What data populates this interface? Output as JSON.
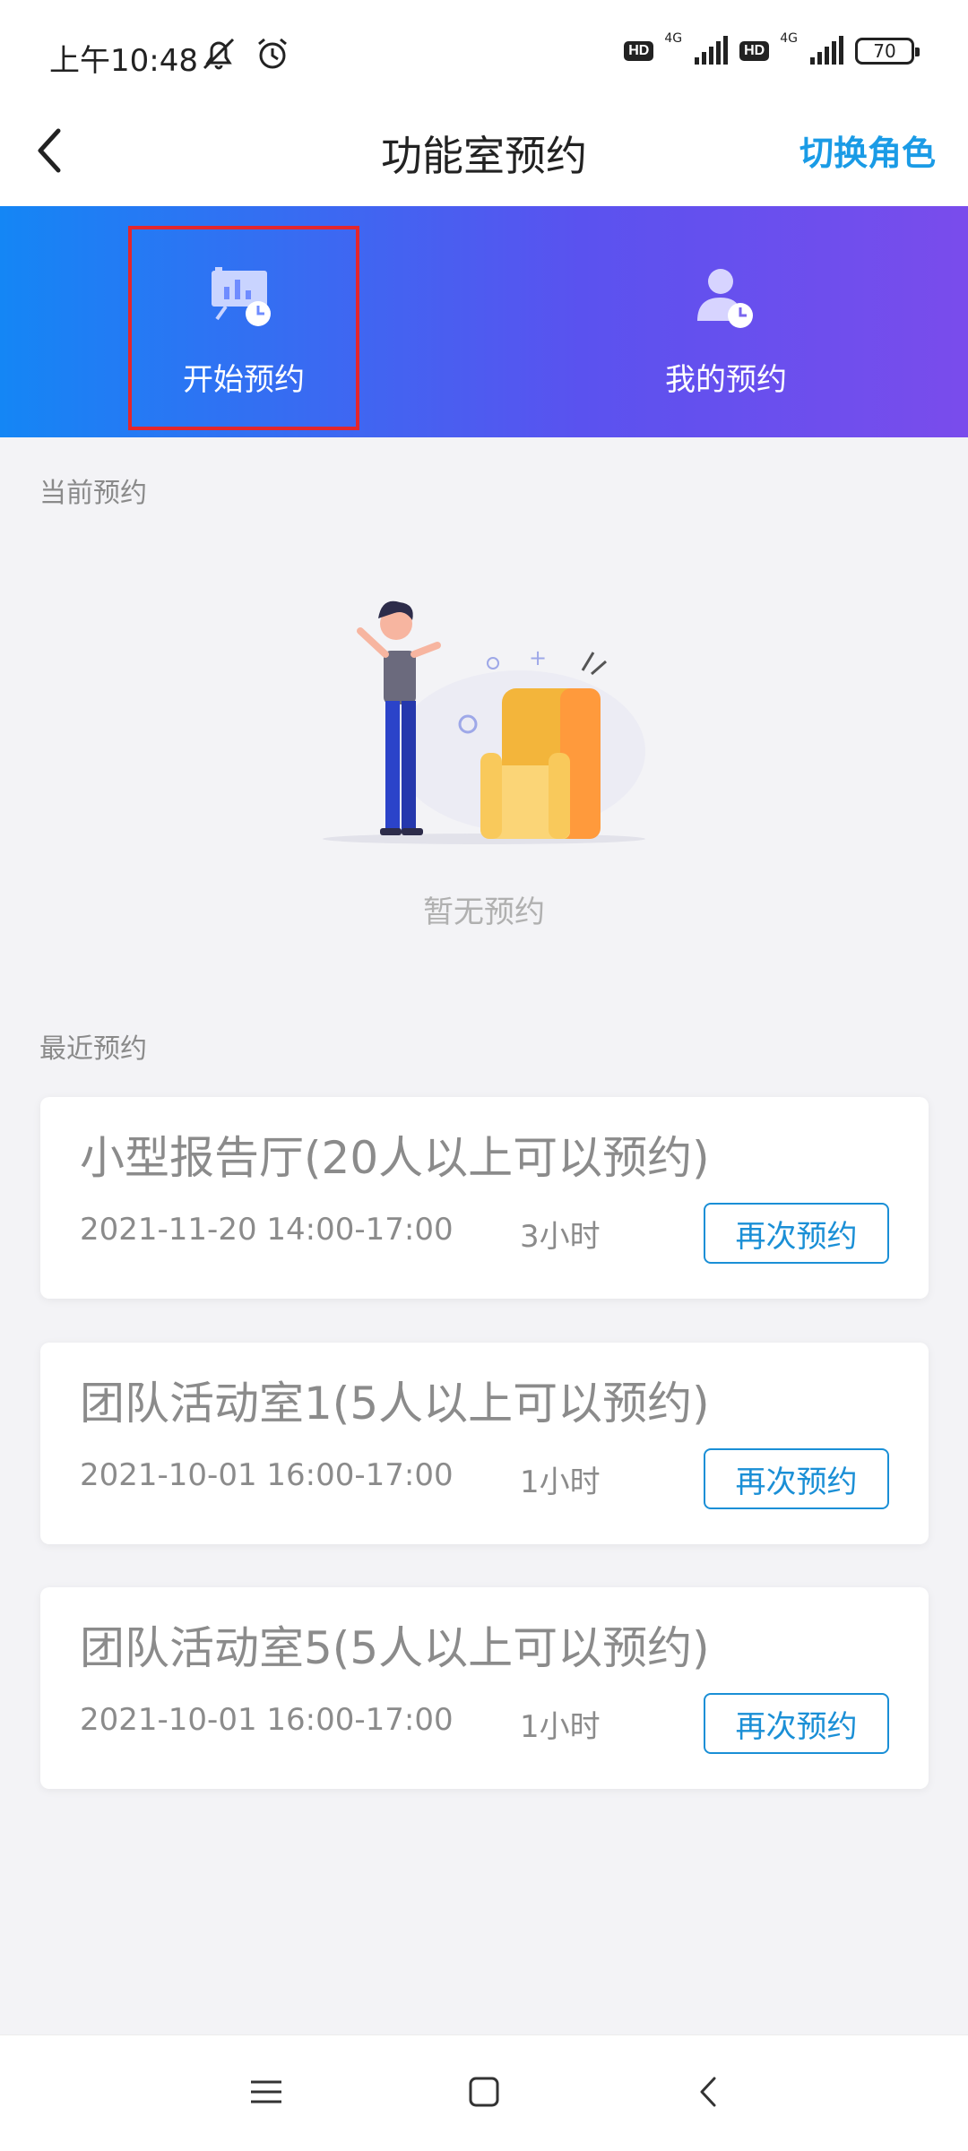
{
  "status_bar": {
    "time": "上午10:48",
    "net_type_1": "4G",
    "net_type_2": "4G",
    "hd_1": "HD",
    "hd_2": "HD",
    "battery": "70"
  },
  "header": {
    "title": "功能室预约",
    "switch_role": "切换角色"
  },
  "banner": {
    "start_label": "开始预约",
    "mine_label": "我的预约"
  },
  "current": {
    "section_title": "当前预约",
    "empty_text": "暂无预约"
  },
  "recent": {
    "section_title": "最近预约",
    "items": [
      {
        "title": "小型报告厅(20人以上可以预约)",
        "date": "2021-11-20 14:00-17:00",
        "duration": "3小时",
        "button": "再次预约"
      },
      {
        "title": "团队活动室1(5人以上可以预约)",
        "date": "2021-10-01 16:00-17:00",
        "duration": "1小时",
        "button": "再次预约"
      },
      {
        "title": "团队活动室5(5人以上可以预约)",
        "date": "2021-10-01 16:00-17:00",
        "duration": "1小时",
        "button": "再次预约"
      }
    ]
  },
  "colors": {
    "accent": "#1a9be6",
    "banner_start": "#1486f5",
    "banner_end": "#7a4cec",
    "highlight": "#e3262c"
  }
}
